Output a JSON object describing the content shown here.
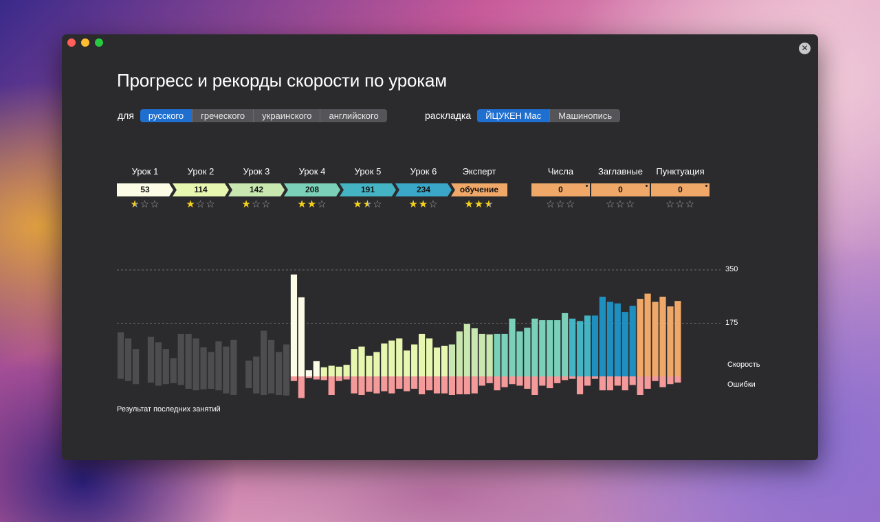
{
  "window": {
    "title": "Прогресс и рекорды скорости по урокам"
  },
  "language_selector": {
    "label": "для",
    "options": [
      "русского",
      "греческого",
      "украинского",
      "английского"
    ],
    "selected": "русского"
  },
  "layout_selector": {
    "label": "раскладка",
    "options": [
      "ЙЦУКЕН Mac",
      "Машинопись"
    ],
    "selected": "ЙЦУКЕН Mac"
  },
  "lessons": [
    {
      "name": "Урок 1",
      "value": "53",
      "stars": 0.5,
      "color": "#fbfbe6"
    },
    {
      "name": "Урок 2",
      "value": "114",
      "stars": 1,
      "color": "#e8f7b0"
    },
    {
      "name": "Урок 3",
      "value": "142",
      "stars": 1,
      "color": "#c8e8b0"
    },
    {
      "name": "Урок 4",
      "value": "208",
      "stars": 2,
      "color": "#7ad0b8"
    },
    {
      "name": "Урок 5",
      "value": "191",
      "stars": 1.5,
      "color": "#44b3c4"
    },
    {
      "name": "Урок 6",
      "value": "234",
      "stars": 2,
      "color": "#3aa6c8"
    },
    {
      "name": "Эксперт",
      "value": "обучение",
      "stars": 2.5,
      "color": "#f0a868"
    }
  ],
  "extras": [
    {
      "name": "Числа",
      "value": "0",
      "stars": 0,
      "color": "#f0a868"
    },
    {
      "name": "Заглавные",
      "value": "0",
      "stars": 0,
      "color": "#f0a868"
    },
    {
      "name": "Пунктуация",
      "value": "0",
      "stars": 0,
      "color": "#f0a868"
    }
  ],
  "chart_data": {
    "type": "bar",
    "y_ticks": [
      350,
      175
    ],
    "ylim": [
      0,
      350
    ],
    "speed_label": "Скорость",
    "errors_label": "Ошибки",
    "caption": "Результат последних занятий",
    "colors": {
      "old": "#4d4d50",
      "lesson1": "#fbfbe6",
      "lesson2": "#e8f7b0",
      "lesson3": "#c8e8b0",
      "lesson4": "#7ad0b8",
      "lesson5": "#44b3c4",
      "lesson6": "#1f8fc0",
      "expert": "#f0a868",
      "errors": "#f49a9a",
      "errors_old": "#4d4d50"
    },
    "bars": [
      {
        "s": 145,
        "e": 8,
        "c": "old"
      },
      {
        "s": 125,
        "e": 15,
        "c": "old"
      },
      {
        "s": 90,
        "e": 25,
        "c": "old"
      },
      {
        "s": 0,
        "e": 0,
        "c": "old"
      },
      {
        "s": 130,
        "e": 20,
        "c": "old"
      },
      {
        "s": 112,
        "e": 30,
        "c": "old"
      },
      {
        "s": 90,
        "e": 25,
        "c": "old"
      },
      {
        "s": 60,
        "e": 22,
        "c": "old"
      },
      {
        "s": 140,
        "e": 28,
        "c": "old"
      },
      {
        "s": 140,
        "e": 40,
        "c": "old"
      },
      {
        "s": 125,
        "e": 45,
        "c": "old"
      },
      {
        "s": 96,
        "e": 42,
        "c": "old"
      },
      {
        "s": 80,
        "e": 40,
        "c": "old"
      },
      {
        "s": 115,
        "e": 45,
        "c": "old"
      },
      {
        "s": 98,
        "e": 55,
        "c": "old"
      },
      {
        "s": 120,
        "e": 60,
        "c": "old"
      },
      {
        "s": 0,
        "e": 0,
        "c": "old"
      },
      {
        "s": 52,
        "e": 38,
        "c": "old"
      },
      {
        "s": 65,
        "e": 55,
        "c": "old"
      },
      {
        "s": 150,
        "e": 60,
        "c": "old"
      },
      {
        "s": 120,
        "e": 55,
        "c": "old"
      },
      {
        "s": 80,
        "e": 60,
        "c": "old"
      },
      {
        "s": 105,
        "e": 62,
        "c": "old"
      },
      {
        "s": 335,
        "e": 15,
        "c": "lesson1"
      },
      {
        "s": 260,
        "e": 70,
        "c": "lesson1"
      },
      {
        "s": 20,
        "e": 5,
        "c": "lesson1"
      },
      {
        "s": 50,
        "e": 10,
        "c": "lesson1"
      },
      {
        "s": 30,
        "e": 12,
        "c": "lesson2"
      },
      {
        "s": 35,
        "e": 60,
        "c": "lesson2"
      },
      {
        "s": 32,
        "e": 15,
        "c": "lesson2"
      },
      {
        "s": 38,
        "e": 10,
        "c": "lesson2"
      },
      {
        "s": 90,
        "e": 55,
        "c": "lesson2"
      },
      {
        "s": 98,
        "e": 60,
        "c": "lesson2"
      },
      {
        "s": 68,
        "e": 50,
        "c": "lesson2"
      },
      {
        "s": 80,
        "e": 55,
        "c": "lesson2"
      },
      {
        "s": 108,
        "e": 48,
        "c": "lesson2"
      },
      {
        "s": 118,
        "e": 55,
        "c": "lesson2"
      },
      {
        "s": 125,
        "e": 40,
        "c": "lesson2"
      },
      {
        "s": 85,
        "e": 48,
        "c": "lesson2"
      },
      {
        "s": 105,
        "e": 40,
        "c": "lesson2"
      },
      {
        "s": 140,
        "e": 58,
        "c": "lesson2"
      },
      {
        "s": 125,
        "e": 45,
        "c": "lesson2"
      },
      {
        "s": 95,
        "e": 55,
        "c": "lesson2"
      },
      {
        "s": 100,
        "e": 55,
        "c": "lesson2"
      },
      {
        "s": 105,
        "e": 60,
        "c": "lesson3"
      },
      {
        "s": 148,
        "e": 58,
        "c": "lesson3"
      },
      {
        "s": 172,
        "e": 58,
        "c": "lesson3"
      },
      {
        "s": 158,
        "e": 55,
        "c": "lesson3"
      },
      {
        "s": 140,
        "e": 30,
        "c": "lesson3"
      },
      {
        "s": 138,
        "e": 22,
        "c": "lesson3"
      },
      {
        "s": 140,
        "e": 45,
        "c": "lesson4"
      },
      {
        "s": 140,
        "e": 35,
        "c": "lesson4"
      },
      {
        "s": 190,
        "e": 25,
        "c": "lesson4"
      },
      {
        "s": 148,
        "e": 30,
        "c": "lesson4"
      },
      {
        "s": 160,
        "e": 40,
        "c": "lesson4"
      },
      {
        "s": 190,
        "e": 60,
        "c": "lesson4"
      },
      {
        "s": 185,
        "e": 30,
        "c": "lesson4"
      },
      {
        "s": 185,
        "e": 38,
        "c": "lesson4"
      },
      {
        "s": 185,
        "e": 22,
        "c": "lesson4"
      },
      {
        "s": 208,
        "e": 12,
        "c": "lesson4"
      },
      {
        "s": 190,
        "e": 8,
        "c": "lesson5"
      },
      {
        "s": 182,
        "e": 58,
        "c": "lesson5"
      },
      {
        "s": 200,
        "e": 30,
        "c": "lesson5"
      },
      {
        "s": 200,
        "e": 8,
        "c": "lesson6"
      },
      {
        "s": 262,
        "e": 45,
        "c": "lesson6"
      },
      {
        "s": 245,
        "e": 45,
        "c": "lesson6"
      },
      {
        "s": 240,
        "e": 30,
        "c": "lesson6"
      },
      {
        "s": 212,
        "e": 45,
        "c": "lesson6"
      },
      {
        "s": 232,
        "e": 28,
        "c": "lesson6"
      },
      {
        "s": 255,
        "e": 60,
        "c": "expert"
      },
      {
        "s": 272,
        "e": 40,
        "c": "expert"
      },
      {
        "s": 245,
        "e": 15,
        "c": "expert"
      },
      {
        "s": 262,
        "e": 35,
        "c": "expert"
      },
      {
        "s": 230,
        "e": 25,
        "c": "expert"
      },
      {
        "s": 248,
        "e": 20,
        "c": "expert"
      }
    ]
  }
}
